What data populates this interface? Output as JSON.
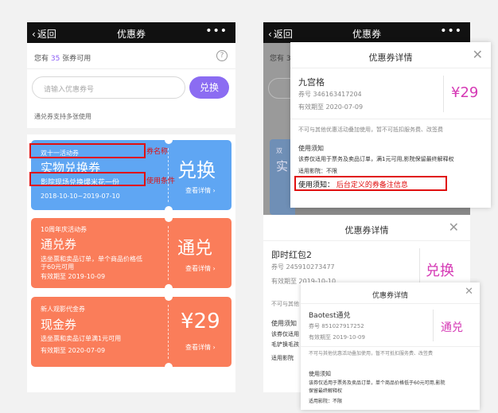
{
  "phone1": {
    "back": "返回",
    "title": "优惠券",
    "more": "•••",
    "count_prefix": "您有",
    "count": "35",
    "count_suffix": "张券可用",
    "help": "?",
    "input_placeholder": "请输入优惠券号",
    "exchange_btn": "兑换",
    "note": "通兑券支持多张使用",
    "cards": [
      {
        "tag": "双十一活动券",
        "name": "实物兑换券",
        "cond": "影院现场兑换爆米花一份",
        "date": "2018-10-10~2019-07-10",
        "big": "兑换",
        "detail": "查看详情 ›",
        "color": "#5fa6f3"
      },
      {
        "tag": "10周年庆活动券",
        "name": "通兑券",
        "cond1": "选坐票和卖品订单，单个商品价格低",
        "cond2": "于60元可用",
        "date": "有效期至 2019-10-09",
        "big": "通兑",
        "detail": "查看详情 ›",
        "color": "#fa7d5a"
      },
      {
        "tag": "新人观影代金券",
        "name": "现金券",
        "cond": "选坐票和卖品订单满1元可用",
        "date": "有效期至 2020-07-09",
        "big": "¥29",
        "detail": "查看详情 ›",
        "color": "#fa7d5a"
      }
    ],
    "anno_name": "券名称",
    "anno_cond": "使用条件"
  },
  "phone2": {
    "back": "返回",
    "title": "优惠券",
    "more": "•••",
    "count_bg": "您有 3",
    "bg_letters": [
      "双",
      "实"
    ],
    "modal1": {
      "title": "优惠券详情",
      "name": "九宫格",
      "code": "券号 346163417204",
      "expire": "有效期至 2020-07-09",
      "value": "¥29",
      "rule": "不可与其他优惠活动叠加使用，暂不可抵扣服务费、改签费",
      "notice_title": "使用须知",
      "notice": "该券仅适用于票务及卖品订单，满1元可用,影院保留最终解释权",
      "cinema": "适用影院：不限",
      "anno": "使用须知：  后台定义的券备注信息"
    },
    "modal2": {
      "title": "优惠券详情",
      "name": "即时红包2",
      "code": "券号 245910273477",
      "expire": "有效期至 2019-10-10",
      "value": "兑换",
      "rule_stub": "不可与其他",
      "stubs": [
        "使用须知",
        "该券仅适用",
        "毛铲换毛孩",
        "适用影院"
      ]
    },
    "modal3": {
      "title": "优惠券详情",
      "name": "Baotest通兑",
      "code": "券号 851027917252",
      "expire": "有效期至 2019-10-09",
      "value": "通兑",
      "rule": "不可与其他优惠活动叠加使用，暂不可抵扣服务费、改签费",
      "notice_title": "使用须知",
      "notice1": "该券仅适用于票务及卖品订单，单个商品价格低于60元可用,影院",
      "notice2": "保留最终解释权",
      "cinema": "适用影院：不限"
    }
  }
}
